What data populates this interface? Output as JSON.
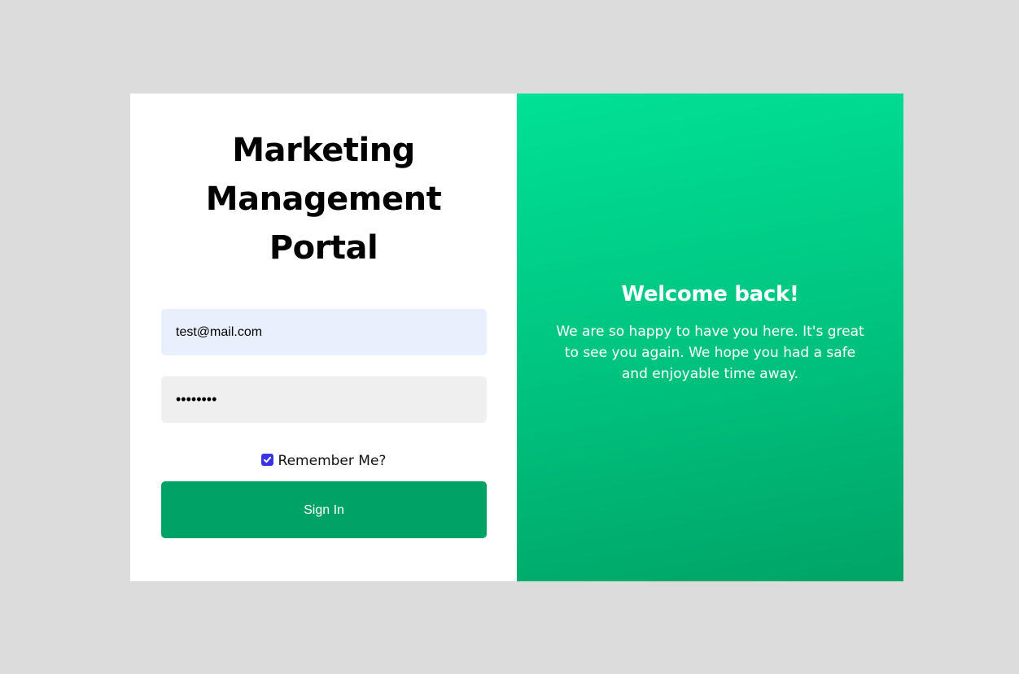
{
  "login": {
    "title": "Marketing Management Portal",
    "email_value": "test@mail.com",
    "password_masked": "••••••••",
    "remember_label": "Remember Me?",
    "remember_checked": true,
    "signin_label": "Sign In"
  },
  "welcome": {
    "heading": "Welcome back!",
    "message": "We are so happy to have you here. It's great to see you again. We hope you had a safe and enjoyable time away."
  },
  "colors": {
    "background": "#dcdcdc",
    "accent": "#00a266",
    "gradient_start": "#00e196",
    "gradient_end": "#00a466",
    "checkbox": "#3a32e6"
  }
}
